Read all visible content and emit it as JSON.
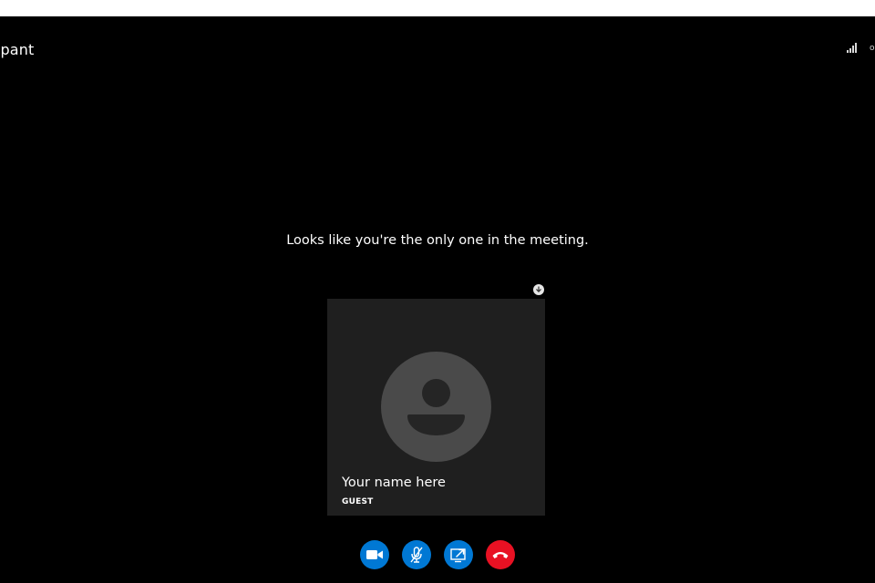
{
  "window": {
    "title": "ipant"
  },
  "status": {
    "signal_icon": "signal-strength-icon",
    "edge_text": "o"
  },
  "meeting": {
    "empty_message": "Looks like you're the only one in the meeting."
  },
  "participant": {
    "name": "Your name here",
    "role": "GUEST",
    "avatar_icon": "default-avatar-icon",
    "badge_icon": "arrow-down-icon"
  },
  "controls": {
    "buttons": [
      {
        "id": "video",
        "icon": "video-camera-icon",
        "color": "#0078d4"
      },
      {
        "id": "mic",
        "icon": "microphone-muted-icon",
        "color": "#0078d4"
      },
      {
        "id": "share",
        "icon": "screen-share-icon",
        "color": "#0078d4"
      },
      {
        "id": "hangup",
        "icon": "phone-hangup-icon",
        "color": "#e81123"
      }
    ]
  },
  "colors": {
    "stage_background": "#000000",
    "card_background": "#1f1f1f",
    "avatar_circle": "#4a4a4a",
    "avatar_figure": "#252525",
    "accent_blue": "#0078d4",
    "hangup_red": "#e81123"
  }
}
